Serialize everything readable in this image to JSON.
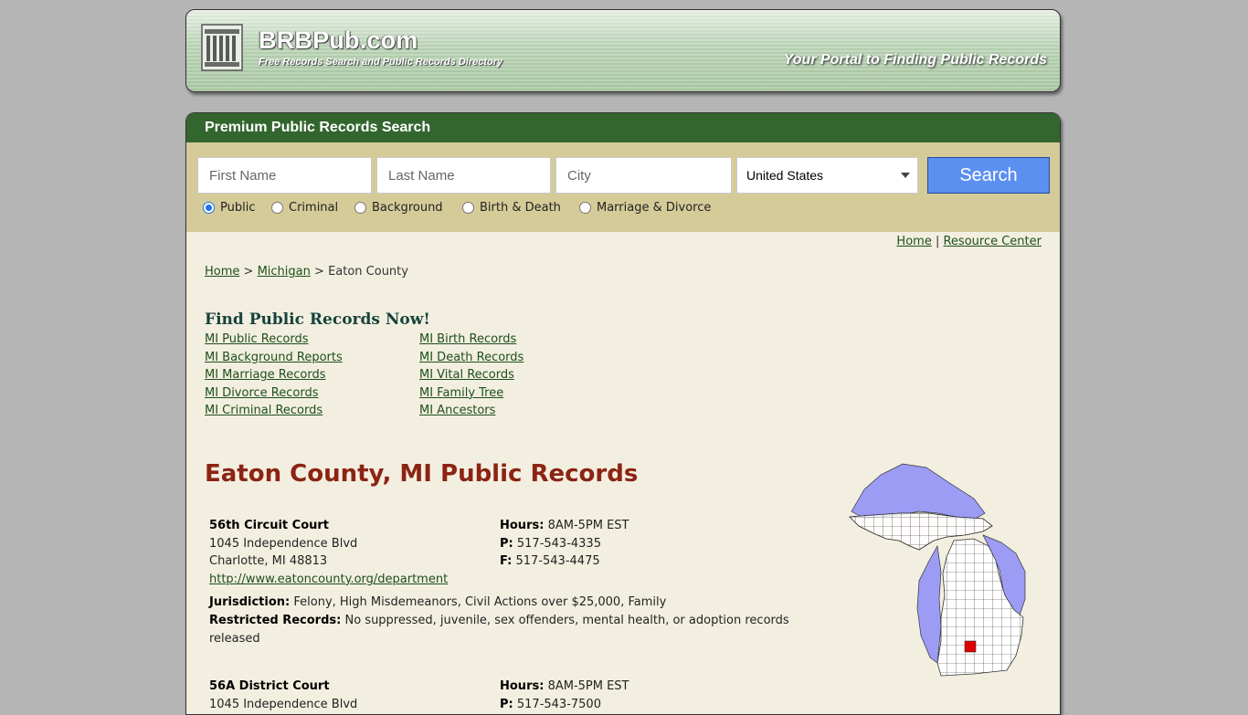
{
  "header": {
    "site_name": "BRBPub.com",
    "tagline": "Free Records Search and Public Records Directory",
    "slogan": "Your Portal to Finding Public Records"
  },
  "search": {
    "title": "Premium Public Records Search",
    "first_name_placeholder": "First Name",
    "last_name_placeholder": "Last Name",
    "city_placeholder": "City",
    "country": "United States",
    "button": "Search",
    "radios": [
      {
        "label": "Public",
        "checked": true
      },
      {
        "label": "Criminal",
        "checked": false
      },
      {
        "label": "Background",
        "checked": false
      },
      {
        "label": "Birth & Death",
        "checked": false
      },
      {
        "label": "Marriage & Divorce",
        "checked": false
      }
    ]
  },
  "toplinks": {
    "home": "Home",
    "sep": "|",
    "resource": "Resource Center"
  },
  "breadcrumb": {
    "home": "Home",
    "sep1": ">",
    "state": "Michigan",
    "sep2": ">",
    "current": "Eaton County"
  },
  "find": {
    "title": "Find Public Records Now!",
    "left": [
      "MI Public Records",
      "MI Background Reports",
      "MI Marriage Records",
      "MI Divorce Records",
      "MI Criminal Records"
    ],
    "right": [
      "MI Birth Records",
      "MI Death Records",
      "MI Vital Records",
      "MI Family Tree",
      "MI Ancestors"
    ]
  },
  "county_title": "Eaton County, MI Public Records",
  "offices": [
    {
      "name": "56th Circuit Court",
      "address1": "1045 Independence Blvd",
      "address2": "Charlotte, MI 48813",
      "url": "http://www.eatoncounty.org/department",
      "hours_label": "Hours:",
      "hours": "8AM-5PM EST",
      "phone_label": "P:",
      "phone": "517-543-4335",
      "fax_label": "F:",
      "fax": "517-543-4475",
      "jurisdiction_label": "Jurisdiction:",
      "jurisdiction": "Felony, High Misdemeanors, Civil Actions over $25,000, Family",
      "restricted_label": "Restricted Records:",
      "restricted": "No suppressed, juvenile, sex offenders, mental health, or adoption records released"
    },
    {
      "name": "56A District Court",
      "address1": "1045 Independence Blvd",
      "hours_label": "Hours:",
      "hours": "8AM-5PM EST",
      "phone_label": "P:",
      "phone": "517-543-7500"
    }
  ],
  "colors": {
    "header_green": "#33662f",
    "title_red": "#8b2414",
    "button_blue": "#5b8ff0",
    "highlight_county": "#e00000"
  }
}
